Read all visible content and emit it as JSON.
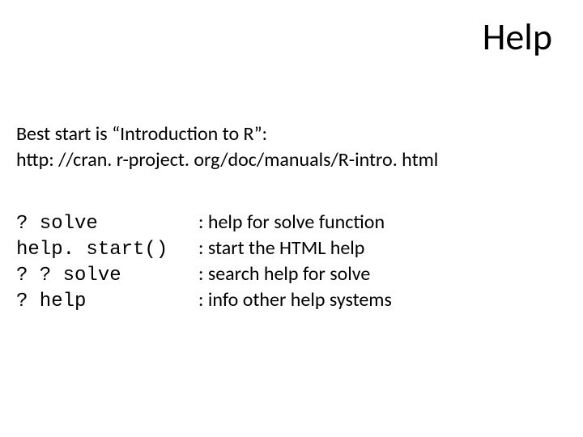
{
  "title": "Help",
  "intro": {
    "line1": "Best start is “Introduction to R”:",
    "line2": "http: //cran. r-project. org/doc/manuals/R-intro. html"
  },
  "commands": [
    {
      "cmd": "? solve",
      "desc": ": help for solve function"
    },
    {
      "cmd": "help. start()",
      "desc": ": start the HTML help"
    },
    {
      "cmd": "? ? solve",
      "desc": ": search help for solve"
    },
    {
      "cmd": "? help",
      "desc": ": info other help systems"
    }
  ]
}
